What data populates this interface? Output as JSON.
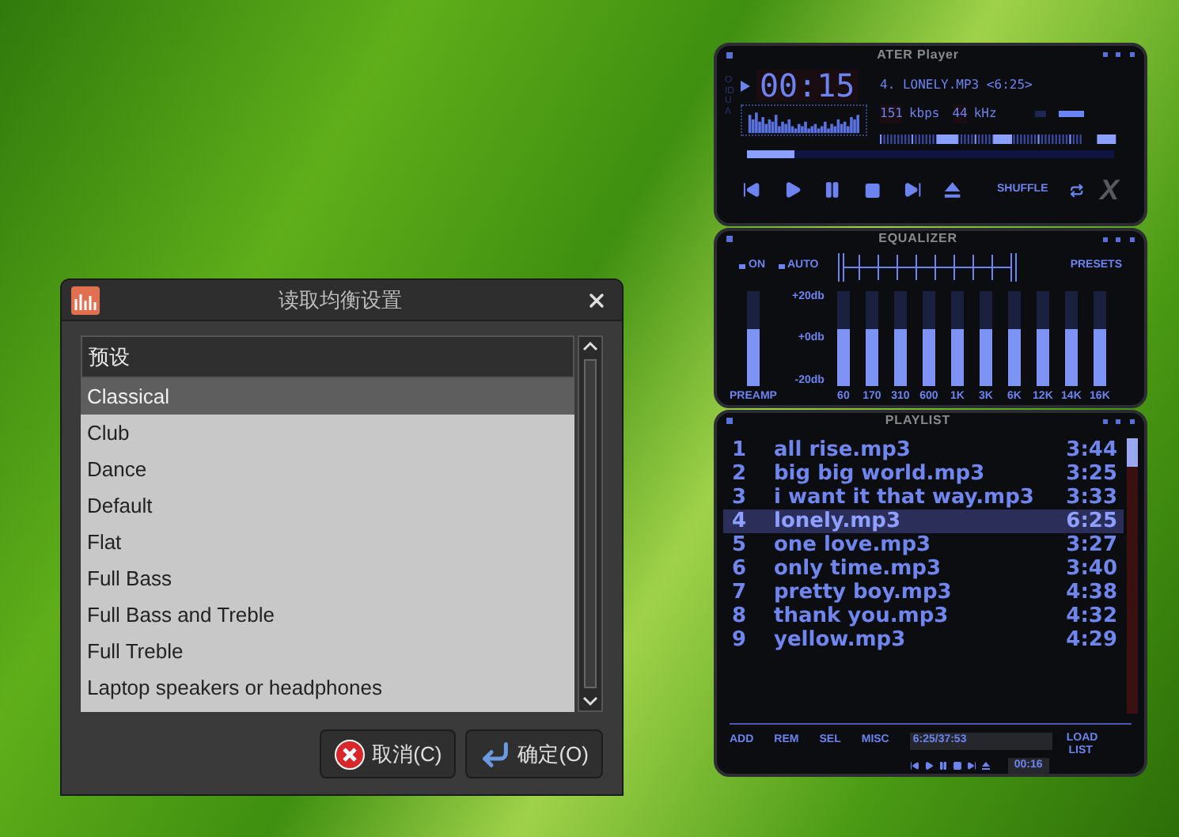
{
  "dialog": {
    "title": "读取均衡设置",
    "list_header": "预设",
    "items": [
      {
        "label": "Classical",
        "selected": true
      },
      {
        "label": "Club",
        "selected": false
      },
      {
        "label": "Dance",
        "selected": false
      },
      {
        "label": "Default",
        "selected": false
      },
      {
        "label": "Flat",
        "selected": false
      },
      {
        "label": "Full Bass",
        "selected": false
      },
      {
        "label": "Full Bass and Treble",
        "selected": false
      },
      {
        "label": "Full Treble",
        "selected": false
      },
      {
        "label": "Laptop speakers or headphones",
        "selected": false
      }
    ],
    "buttons": [
      {
        "kind": "cancel",
        "label": "取消(C)"
      },
      {
        "kind": "ok",
        "label": "确定(O)"
      }
    ]
  },
  "player": {
    "title": "ATER Player",
    "side_label": "OIDUA",
    "time": "00:15",
    "track": "4. LONELY.MP3 <6:25>",
    "bitrate": "151",
    "bitrate_unit": "kbps",
    "samplerate": "44",
    "samplerate_unit": "kHz",
    "position": {
      "level": 0.13
    },
    "shuffle": "SHUFFLE",
    "logo": "X"
  },
  "equalizer": {
    "title": "EQUALIZER",
    "on_label": "ON",
    "auto_label": "AUTO",
    "presets": "PRESETS",
    "scale": [
      "+20db",
      "+0db",
      "-20db"
    ],
    "preamp": {
      "label": "PREAMP",
      "level": 0.6
    },
    "bands": [
      {
        "label": "60",
        "level": 0.6
      },
      {
        "label": "170",
        "level": 0.6
      },
      {
        "label": "310",
        "level": 0.6
      },
      {
        "label": "600",
        "level": 0.6
      },
      {
        "label": "1K",
        "level": 0.6
      },
      {
        "label": "3K",
        "level": 0.6
      },
      {
        "label": "6K",
        "level": 0.6
      },
      {
        "label": "12K",
        "level": 0.6
      },
      {
        "label": "14K",
        "level": 0.6
      },
      {
        "label": "16K",
        "level": 0.6
      }
    ]
  },
  "playlist": {
    "title": "PLAYLIST",
    "tracks": [
      {
        "number": "1",
        "title": "all rise.mp3",
        "time": "3:44",
        "selected": false
      },
      {
        "number": "2",
        "title": "big big world.mp3",
        "time": "3:25",
        "selected": false
      },
      {
        "number": "3",
        "title": "i want it that way.mp3",
        "time": "3:33",
        "selected": false
      },
      {
        "number": "4",
        "title": "lonely.mp3",
        "time": "6:25",
        "selected": true
      },
      {
        "number": "5",
        "title": "one love.mp3",
        "time": "3:27",
        "selected": false
      },
      {
        "number": "6",
        "title": "only time.mp3",
        "time": "3:40",
        "selected": false
      },
      {
        "number": "7",
        "title": "pretty boy.mp3",
        "time": "4:38",
        "selected": false
      },
      {
        "number": "8",
        "title": "thank you.mp3",
        "time": "4:32",
        "selected": false
      },
      {
        "number": "9",
        "title": "yellow.mp3",
        "time": "4:29",
        "selected": false
      }
    ],
    "buttons": [
      "ADD",
      "REM",
      "SEL",
      "MISC"
    ],
    "total": "6:25/37:53",
    "elapsed": "00:16",
    "load_list": "LOAD LIST"
  }
}
